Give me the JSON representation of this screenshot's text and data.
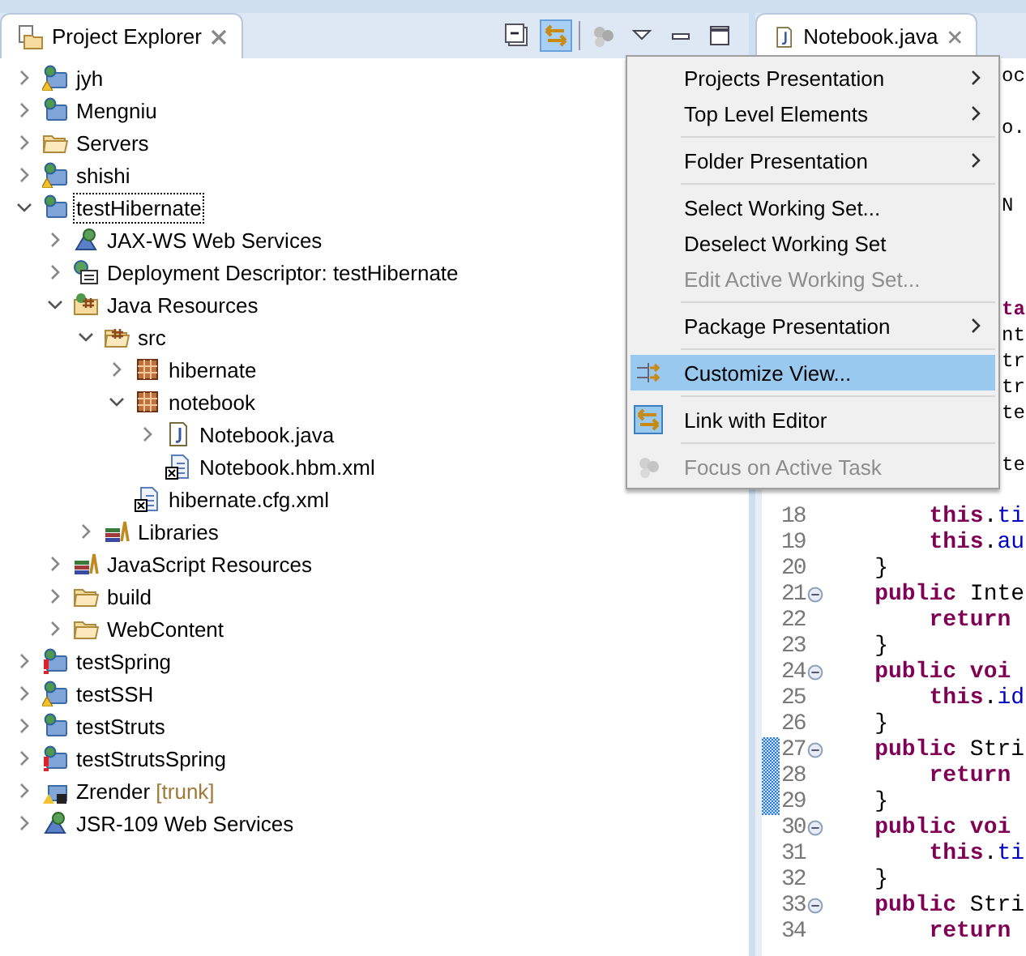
{
  "explorer": {
    "title": "Project Explorer",
    "toolbar": [
      {
        "kind": "collapse",
        "selected": false
      },
      {
        "kind": "link",
        "selected": true
      },
      {
        "kind": "focus",
        "selected": false
      },
      {
        "kind": "menu",
        "selected": false
      },
      {
        "kind": "minimize",
        "selected": false
      },
      {
        "kind": "maximize",
        "selected": false
      }
    ],
    "tree": [
      {
        "label": "jyh",
        "kind": "project-warning",
        "expanded": false,
        "selected": false
      },
      {
        "label": "Mengniu",
        "kind": "project",
        "expanded": false,
        "selected": false
      },
      {
        "label": "Servers",
        "kind": "folder",
        "expanded": false,
        "selected": false
      },
      {
        "label": "shishi",
        "kind": "project-warning",
        "expanded": false,
        "selected": false
      },
      {
        "label": "testHibernate",
        "kind": "project",
        "expanded": true,
        "selected": true,
        "children": [
          {
            "label": "JAX-WS Web Services",
            "kind": "webservices",
            "expanded": false,
            "selected": false
          },
          {
            "label": "Deployment Descriptor: testHibernate",
            "kind": "descriptor",
            "expanded": false,
            "selected": false
          },
          {
            "label": "Java Resources",
            "kind": "javaresources",
            "expanded": true,
            "selected": false,
            "children": [
              {
                "label": "src",
                "kind": "src",
                "expanded": true,
                "selected": false,
                "children": [
                  {
                    "label": "hibernate",
                    "kind": "package",
                    "expanded": false,
                    "selected": false
                  },
                  {
                    "label": "notebook",
                    "kind": "package",
                    "expanded": true,
                    "selected": false,
                    "children": [
                      {
                        "label": "Notebook.java",
                        "kind": "javafile",
                        "expanded": false,
                        "selected": false
                      },
                      {
                        "label": "Notebook.hbm.xml",
                        "kind": "xmlfile",
                        "selected": false
                      }
                    ]
                  },
                  {
                    "label": "hibernate.cfg.xml",
                    "kind": "xmlfile",
                    "selected": false
                  }
                ]
              },
              {
                "label": "Libraries",
                "kind": "libraries",
                "expanded": false,
                "selected": false
              }
            ]
          },
          {
            "label": "JavaScript Resources",
            "kind": "libraries",
            "expanded": false,
            "selected": false
          },
          {
            "label": "build",
            "kind": "folder",
            "expanded": false,
            "selected": false
          },
          {
            "label": "WebContent",
            "kind": "folder",
            "expanded": false,
            "selected": false
          }
        ]
      },
      {
        "label": "testSpring",
        "kind": "project-error",
        "expanded": false,
        "selected": false
      },
      {
        "label": "testSSH",
        "kind": "project-warning",
        "expanded": false,
        "selected": false
      },
      {
        "label": "testStruts",
        "kind": "project",
        "expanded": false,
        "selected": false
      },
      {
        "label": "testStrutsSpring",
        "kind": "project-error",
        "expanded": false,
        "selected": false
      },
      {
        "label": "Zrender",
        "decoration": "[trunk]",
        "kind": "svnproject",
        "expanded": false,
        "selected": false
      },
      {
        "label": "JSR-109 Web Services",
        "kind": "webservices",
        "expanded": false,
        "selected": false
      }
    ]
  },
  "editor": {
    "tab": {
      "title": "Notebook.java"
    },
    "lines": [
      {
        "kind": "fragment",
        "segments": [
          {
            "kind": "plain",
            "text": "oc"
          }
        ]
      },
      {
        "kind": "blank"
      },
      {
        "kind": "fragment",
        "segments": [
          {
            "kind": "plain",
            "text": "o."
          }
        ]
      },
      {
        "kind": "blank"
      },
      {
        "kind": "blank"
      },
      {
        "kind": "fragment",
        "segments": [
          {
            "kind": "plain",
            "text": "N"
          }
        ]
      },
      {
        "kind": "blank"
      },
      {
        "kind": "blank"
      },
      {
        "kind": "blank"
      },
      {
        "kind": "fragment",
        "segments": [
          {
            "kind": "keyword",
            "text": "ta"
          }
        ]
      },
      {
        "kind": "fragment",
        "segments": [
          {
            "kind": "plain",
            "text": "nt"
          }
        ]
      },
      {
        "kind": "fragment",
        "segments": [
          {
            "kind": "plain",
            "text": "tr"
          }
        ]
      },
      {
        "kind": "fragment",
        "segments": [
          {
            "kind": "plain",
            "text": "tr"
          }
        ]
      },
      {
        "kind": "fragment",
        "segments": [
          {
            "kind": "plain",
            "text": "te"
          }
        ]
      },
      {
        "kind": "blank"
      },
      {
        "kind": "fragment",
        "segments": [
          {
            "kind": "plain",
            "text": "te"
          }
        ]
      },
      {
        "kind": "blank"
      },
      {
        "kind": "code",
        "number": "18",
        "fold": false,
        "changed": false,
        "segments": [
          {
            "kind": "keyword",
            "text": "        this"
          },
          {
            "kind": "plain",
            "text": "."
          },
          {
            "kind": "field",
            "text": "ti"
          }
        ]
      },
      {
        "kind": "code",
        "number": "19",
        "fold": false,
        "changed": false,
        "segments": [
          {
            "kind": "keyword",
            "text": "        this"
          },
          {
            "kind": "plain",
            "text": "."
          },
          {
            "kind": "field",
            "text": "au"
          }
        ]
      },
      {
        "kind": "code",
        "number": "20",
        "fold": false,
        "changed": false,
        "segments": [
          {
            "kind": "plain",
            "text": "    }"
          }
        ]
      },
      {
        "kind": "code",
        "number": "21",
        "fold": true,
        "changed": false,
        "segments": [
          {
            "kind": "keyword",
            "text": "    public"
          },
          {
            "kind": "plain",
            "text": " Inte"
          }
        ]
      },
      {
        "kind": "code",
        "number": "22",
        "fold": false,
        "changed": false,
        "segments": [
          {
            "kind": "keyword",
            "text": "        return"
          }
        ]
      },
      {
        "kind": "code",
        "number": "23",
        "fold": false,
        "changed": false,
        "segments": [
          {
            "kind": "plain",
            "text": "    }"
          }
        ]
      },
      {
        "kind": "code",
        "number": "24",
        "fold": true,
        "changed": false,
        "segments": [
          {
            "kind": "keyword",
            "text": "    public voi"
          }
        ]
      },
      {
        "kind": "code",
        "number": "25",
        "fold": false,
        "changed": false,
        "segments": [
          {
            "kind": "keyword",
            "text": "        this"
          },
          {
            "kind": "plain",
            "text": "."
          },
          {
            "kind": "field",
            "text": "id"
          }
        ]
      },
      {
        "kind": "code",
        "number": "26",
        "fold": false,
        "changed": false,
        "segments": [
          {
            "kind": "plain",
            "text": "    }"
          }
        ]
      },
      {
        "kind": "code",
        "number": "27",
        "fold": true,
        "changed": true,
        "segments": [
          {
            "kind": "keyword",
            "text": "    public"
          },
          {
            "kind": "plain",
            "text": " Stri"
          }
        ]
      },
      {
        "kind": "code",
        "number": "28",
        "fold": false,
        "changed": true,
        "segments": [
          {
            "kind": "keyword",
            "text": "        return"
          }
        ]
      },
      {
        "kind": "code",
        "number": "29",
        "fold": false,
        "changed": true,
        "segments": [
          {
            "kind": "plain",
            "text": "    }"
          }
        ]
      },
      {
        "kind": "code",
        "number": "30",
        "fold": true,
        "changed": false,
        "segments": [
          {
            "kind": "keyword",
            "text": "    public voi"
          }
        ]
      },
      {
        "kind": "code",
        "number": "31",
        "fold": false,
        "changed": false,
        "segments": [
          {
            "kind": "keyword",
            "text": "        this"
          },
          {
            "kind": "plain",
            "text": "."
          },
          {
            "kind": "field",
            "text": "ti"
          }
        ]
      },
      {
        "kind": "code",
        "number": "32",
        "fold": false,
        "changed": false,
        "segments": [
          {
            "kind": "plain",
            "text": "    }"
          }
        ]
      },
      {
        "kind": "code",
        "number": "33",
        "fold": true,
        "changed": false,
        "segments": [
          {
            "kind": "keyword",
            "text": "    public"
          },
          {
            "kind": "plain",
            "text": " Stri"
          }
        ]
      },
      {
        "kind": "code",
        "number": "34",
        "fold": false,
        "changed": false,
        "segments": [
          {
            "kind": "keyword",
            "text": "        return"
          }
        ]
      }
    ]
  },
  "menu": [
    {
      "kind": "item",
      "label": "Projects Presentation",
      "submenu": true,
      "disabled": false,
      "selected": false
    },
    {
      "kind": "item",
      "label": "Top Level Elements",
      "submenu": true,
      "disabled": false,
      "selected": false
    },
    {
      "kind": "separator"
    },
    {
      "kind": "item",
      "label": "Folder Presentation",
      "submenu": true,
      "disabled": false,
      "selected": false
    },
    {
      "kind": "separator"
    },
    {
      "kind": "item",
      "label": "Select Working Set...",
      "submenu": false,
      "disabled": false,
      "selected": false
    },
    {
      "kind": "item",
      "label": "Deselect Working Set",
      "submenu": false,
      "disabled": false,
      "selected": false
    },
    {
      "kind": "item",
      "label": "Edit Active Working Set...",
      "submenu": false,
      "disabled": true,
      "selected": false
    },
    {
      "kind": "separator"
    },
    {
      "kind": "item",
      "label": "Package Presentation",
      "submenu": true,
      "disabled": false,
      "selected": false
    },
    {
      "kind": "separator"
    },
    {
      "kind": "customize",
      "label": "Customize View...",
      "submenu": false,
      "disabled": false,
      "selected": true,
      "checked": false
    },
    {
      "kind": "separator"
    },
    {
      "kind": "link",
      "label": "Link with Editor",
      "submenu": false,
      "disabled": false,
      "selected": false,
      "checked": true
    },
    {
      "kind": "separator"
    },
    {
      "kind": "focus",
      "label": "Focus on Active Task",
      "submenu": false,
      "disabled": true,
      "selected": false,
      "checked": false
    }
  ]
}
